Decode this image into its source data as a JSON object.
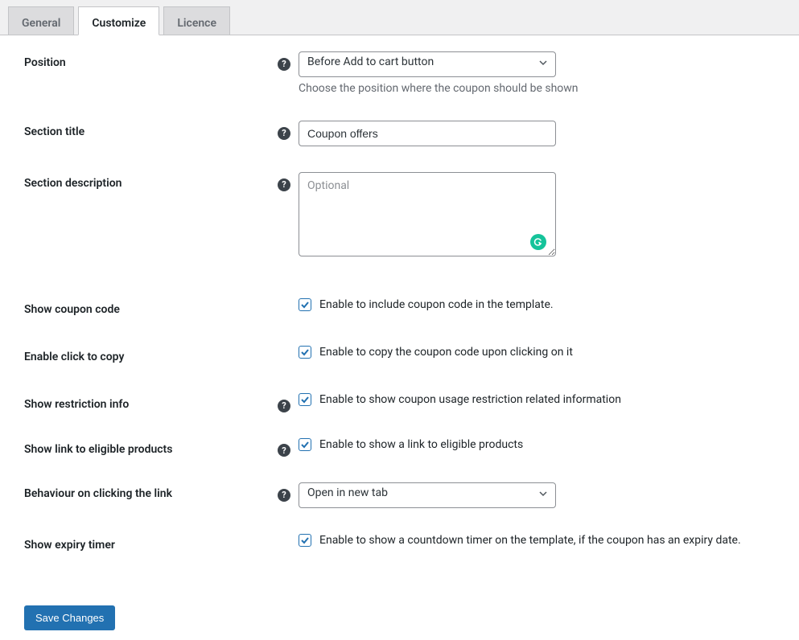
{
  "tabs": {
    "general": "General",
    "customize": "Customize",
    "licence": "Licence"
  },
  "fields": {
    "position": {
      "label": "Position",
      "value": "Before Add to cart button",
      "description": "Choose the position where the coupon should be shown"
    },
    "section_title": {
      "label": "Section title",
      "value": "Coupon offers"
    },
    "section_description": {
      "label": "Section description",
      "placeholder": "Optional",
      "value": ""
    },
    "show_coupon_code": {
      "label": "Show coupon code",
      "text": "Enable to include coupon code in the template."
    },
    "enable_click_copy": {
      "label": "Enable click to copy",
      "text": "Enable to copy the coupon code upon clicking on it"
    },
    "show_restriction": {
      "label": "Show restriction info",
      "text": "Enable to show coupon usage restriction related information"
    },
    "show_link_eligible": {
      "label": "Show link to eligible products",
      "text": "Enable to show a link to eligible products"
    },
    "behaviour_link": {
      "label": "Behaviour on clicking the link",
      "value": "Open in new tab"
    },
    "show_expiry": {
      "label": "Show expiry timer",
      "text": "Enable to show a countdown timer on the template, if the coupon has an expiry date."
    }
  },
  "save_button": "Save Changes"
}
